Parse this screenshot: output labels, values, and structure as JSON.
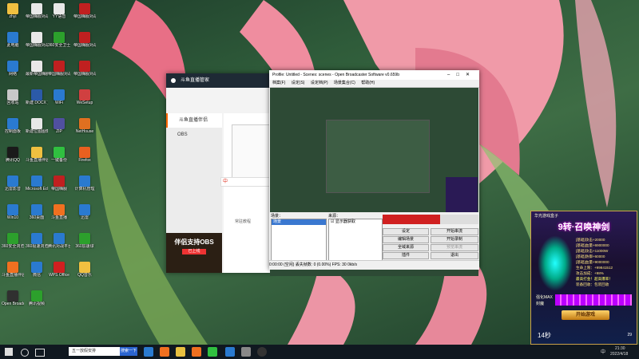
{
  "desktop": {
    "icons": [
      {
        "label": "zhyi",
        "color": "#f0c040"
      },
      {
        "label": "帝国嗨服对战平台",
        "color": "#e8e8e8"
      },
      {
        "label": "YY语音",
        "color": "#e8e8e8"
      },
      {
        "label": "帝国嗨服对战平台",
        "color": "#c02020"
      },
      {
        "label": "此电脑",
        "color": "#2a7ad0"
      },
      {
        "label": "帝国嗨服对战平台ver5.0W",
        "color": "#e8e8e8"
      },
      {
        "label": "360安全卫士",
        "color": "#2ca02c"
      },
      {
        "label": "帝国嗨服对战平台ver5.0W",
        "color": "#c02020"
      },
      {
        "label": "网络",
        "color": "#2a7ad0"
      },
      {
        "label": "最新帝国嗨服对战平台",
        "color": "#e8e8e8"
      },
      {
        "label": "帝国嗨服对战平台",
        "color": "#c02020"
      },
      {
        "label": "帝国嗨服对战平台ver5.0W",
        "color": "#c02020"
      },
      {
        "label": "回收站",
        "color": "#c8c8c8"
      },
      {
        "label": "新建 DOCX 文档",
        "color": "#2b5aa8"
      },
      {
        "label": "WiFi",
        "color": "#2a7ad0"
      },
      {
        "label": "WeSetup",
        "color": "#d04040"
      },
      {
        "label": "控制面板",
        "color": "#2a7ad0"
      },
      {
        "label": "新建位图图像",
        "color": "#e8e8e8"
      },
      {
        "label": "ZIP",
        "color": "#5050a0"
      },
      {
        "label": "NetHouse",
        "color": "#e07020"
      },
      {
        "label": "腾讯QQ",
        "color": "#1a1a1a"
      },
      {
        "label": "斗鱼直播伴侣",
        "color": "#f0c040"
      },
      {
        "label": "一键备份",
        "color": "#30c040"
      },
      {
        "label": "Firefox",
        "color": "#e86020"
      },
      {
        "label": "迅雷影音",
        "color": "#2a7ad0"
      },
      {
        "label": "Microsoft Edge",
        "color": "#2a7ad0"
      },
      {
        "label": "帝国嗨服",
        "color": "#c02020"
      },
      {
        "label": "计算机管理",
        "color": "#2a7ad0"
      },
      {
        "label": "Win10",
        "color": "#2a7ad0"
      },
      {
        "label": "360桌面",
        "color": "#2a7ad0"
      },
      {
        "label": "斗鱼直播",
        "color": "#f07020"
      },
      {
        "label": "迅雷",
        "color": "#2a7ad0"
      },
      {
        "label": "360安全浏览器",
        "color": "#2ca02c"
      },
      {
        "label": "360极速浏览器",
        "color": "#2a7ad0"
      },
      {
        "label": "腾讯对战平台",
        "color": "#2a7ad0"
      },
      {
        "label": "360加速球",
        "color": "#2ca02c"
      },
      {
        "label": "斗鱼直播伴侣",
        "color": "#f07020"
      },
      {
        "label": "微信",
        "color": "#2a7ad0"
      },
      {
        "label": "WPS Office",
        "color": "#d02020"
      },
      {
        "label": "QQ音乐",
        "color": "#f0c040"
      },
      {
        "label": "Open Broadcaster",
        "color": "#303030"
      },
      {
        "label": "腾讯视频",
        "color": "#2ca02c"
      }
    ]
  },
  "douyu": {
    "title": "斗鱼直播管家",
    "side_items": [
      "斗鱼直播伴侣",
      "OBS"
    ],
    "link": "常驻教程",
    "banner": "伴侣支持OBS",
    "banner_sub": "已上线",
    "ime_tip": "中"
  },
  "obs": {
    "title": "Profile: Untitled - Scenes: scenes - Open Broadcaster Software v0.659b",
    "menu": [
      "档案(F)",
      "设定(S)",
      "设定档(P)",
      "场景集合(C)",
      "帮助(H)"
    ],
    "scenes_label": "场景：",
    "sources_label": "来源：",
    "scene_item": "场景",
    "source_item": "显示器获取",
    "buttons": [
      "设定",
      "开始串流",
      "编辑场景",
      "开始录制",
      "全域来源",
      "预览串流",
      "插件",
      "退出"
    ],
    "status": "0:00:00 (空闲)   丢失帧数: 0 (0.00%)   FPS: 30   0kb/s"
  },
  "ad": {
    "brand": "华光游戏盒子",
    "title": "9转·召唤神剑",
    "lines": [
      "[基础]攻击+20000",
      "[基础]血量+6900000",
      "[基础]攻击+11000W",
      "[基础]防御+60000",
      "[基础]血量+9000000",
      "生命上限：+99841512",
      "攻击加成：+98%",
      "最高打金！超高爆率！",
      "装备回收：包装回收"
    ],
    "max_label": "强化MAX",
    "tag": "封魔",
    "cta": "开始游戏",
    "timer": "14秒",
    "right_num": "29"
  },
  "taskbar": {
    "search_placeholder": "五一放假安排",
    "search_button": "搜索一下",
    "time": "21:30",
    "date": "2022/4/18",
    "lang": "中"
  }
}
